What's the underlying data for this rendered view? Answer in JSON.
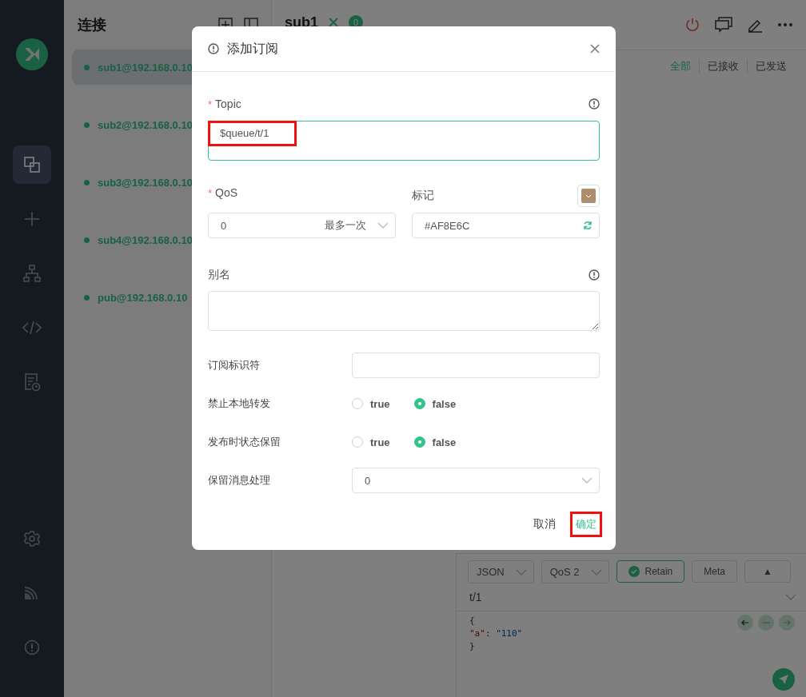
{
  "sidebar": {
    "nav": [
      {
        "kind": "connections",
        "selected": true
      },
      {
        "kind": "new",
        "selected": false
      },
      {
        "kind": "topology",
        "selected": false
      },
      {
        "kind": "script",
        "selected": false
      },
      {
        "kind": "log",
        "selected": false
      },
      {
        "kind": "settings",
        "selected": false
      },
      {
        "kind": "feed",
        "selected": false
      },
      {
        "kind": "about",
        "selected": false
      }
    ]
  },
  "connections": {
    "title": "连接",
    "items": [
      {
        "label": "sub1@192.168.0.10",
        "selected": true
      },
      {
        "label": "sub2@192.168.0.10",
        "selected": false
      },
      {
        "label": "sub3@192.168.0.10",
        "selected": false
      },
      {
        "label": "sub4@192.168.0.10",
        "selected": false
      },
      {
        "label": "pub@192.168.0.10",
        "selected": false
      }
    ]
  },
  "main": {
    "title": "sub1",
    "badge": "0",
    "filters": [
      {
        "label": "全部",
        "selected": true
      },
      {
        "label": "已接收",
        "selected": false
      },
      {
        "label": "已发送",
        "selected": false
      }
    ]
  },
  "publish": {
    "format": "JSON",
    "qos": "QoS 2",
    "retain": {
      "label": "Retain",
      "checked": true
    },
    "meta": "Meta",
    "expand": "▲",
    "topic": "t/1",
    "payload": [
      [
        {
          "kind": "punct",
          "text": "{"
        }
      ],
      [
        {
          "kind": "key",
          "text": "\"a\""
        },
        {
          "kind": "punct",
          "text": ": "
        },
        {
          "kind": "string",
          "text": "\"110\""
        }
      ],
      [
        {
          "kind": "punct",
          "text": "}"
        }
      ]
    ]
  },
  "dialog": {
    "title": "添加订阅",
    "topic": {
      "label": "Topic",
      "required_mark": "*",
      "value": "$queue/t/1",
      "highlighted": true
    },
    "qos": {
      "label": "QoS",
      "required_mark": "*",
      "value": "0",
      "hint": "最多一次"
    },
    "mark": {
      "label": "标记",
      "color": "#af8e6c",
      "value": "#AF8E6C"
    },
    "alias": {
      "label": "别名"
    },
    "rows": [
      {
        "kind": "input",
        "label": "订阅标识符"
      },
      {
        "kind": "radio",
        "label": "禁止本地转发",
        "options": [
          {
            "label": "true",
            "selected": false
          },
          {
            "label": "false",
            "selected": true
          }
        ]
      },
      {
        "kind": "radio",
        "label": "发布时状态保留",
        "options": [
          {
            "label": "true",
            "selected": false
          },
          {
            "label": "false",
            "selected": true
          }
        ]
      },
      {
        "kind": "select",
        "label": "保留消息处理",
        "value": "0"
      }
    ],
    "cancel": "取消",
    "ok": {
      "label": "确定",
      "highlighted": true
    }
  }
}
